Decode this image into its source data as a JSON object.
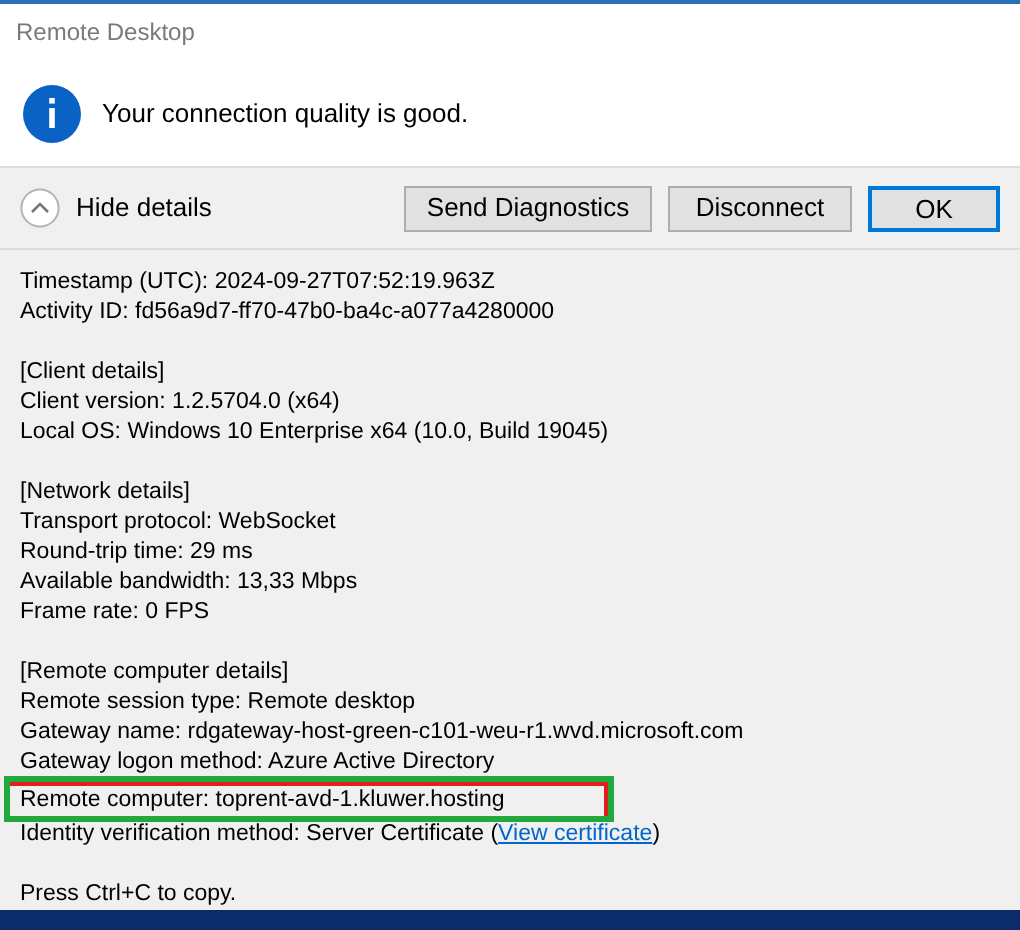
{
  "window": {
    "title": "Remote Desktop"
  },
  "message": "Your connection quality is good.",
  "toggle": {
    "label": "Hide details",
    "expanded": true
  },
  "buttons": [
    {
      "label": "Send Diagnostics",
      "default": false
    },
    {
      "label": "Disconnect",
      "default": false
    },
    {
      "label": "OK",
      "default": true
    }
  ],
  "details": [
    [
      {
        "text": "Timestamp (UTC): 2024-09-27T07:52:19.963Z"
      },
      {
        "text": "Activity ID: fd56a9d7-ff70-47b0-ba4c-a077a4280000"
      }
    ],
    [
      {
        "text": "[Client details]"
      },
      {
        "text": "Client version: 1.2.5704.0 (x64)"
      },
      {
        "text": "Local OS: Windows 10 Enterprise x64 (10.0, Build 19045)"
      }
    ],
    [
      {
        "text": "[Network details]"
      },
      {
        "text": "Transport protocol: WebSocket"
      },
      {
        "text": "Round-trip time: 29 ms"
      },
      {
        "text": "Available bandwidth: 13,33 Mbps"
      },
      {
        "text": "Frame rate: 0 FPS"
      }
    ],
    [
      {
        "text": "[Remote computer details]"
      },
      {
        "text": "Remote session type: Remote desktop"
      },
      {
        "text": "Gateway name: rdgateway-host-green-c101-weu-r1.wvd.microsoft.com"
      },
      {
        "text": "Gateway logon method: Azure Active Directory"
      },
      {
        "text": "Remote computer: toprent-avd-1.kluwer.hosting",
        "highlighted": true
      },
      {
        "text": "Identity verification method: Server Certificate (",
        "link": "View certificate",
        "after": ")"
      }
    ],
    [
      {
        "text": "Press Ctrl+C to copy."
      }
    ]
  ]
}
